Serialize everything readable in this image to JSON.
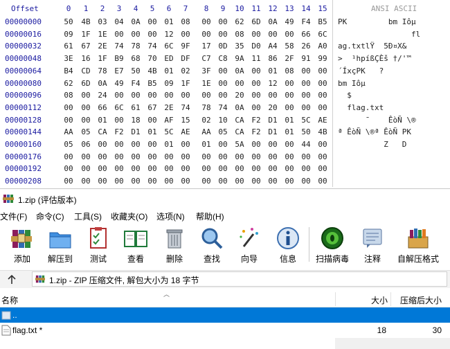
{
  "hex": {
    "offset_header": "Offset",
    "columns": [
      "0",
      "1",
      "2",
      "3",
      "4",
      "5",
      "6",
      "7",
      "8",
      "9",
      "10",
      "11",
      "12",
      "13",
      "14",
      "15"
    ],
    "ascii_header": "ANSI ASCII",
    "rows": [
      {
        "offset": "00000000",
        "bytes": [
          "50",
          "4B",
          "03",
          "04",
          "0A",
          "00",
          "01",
          "08",
          "00",
          "00",
          "62",
          "6D",
          "0A",
          "49",
          "F4",
          "B5"
        ],
        "ascii": "PK         bm Iôµ"
      },
      {
        "offset": "00000016",
        "bytes": [
          "09",
          "1F",
          "1E",
          "00",
          "00",
          "00",
          "12",
          "00",
          "00",
          "00",
          "08",
          "00",
          "00",
          "00",
          "66",
          "6C"
        ],
        "ascii": "                fl"
      },
      {
        "offset": "00000032",
        "bytes": [
          "61",
          "67",
          "2E",
          "74",
          "78",
          "74",
          "6C",
          "9F",
          "17",
          "0D",
          "35",
          "D0",
          "A4",
          "58",
          "26",
          "A0"
        ],
        "ascii": "ag.txtlŸ  5Ð¤X&"
      },
      {
        "offset": "00000048",
        "bytes": [
          "3E",
          "16",
          "1F",
          "B9",
          "68",
          "70",
          "ED",
          "DF",
          "C7",
          "C8",
          "9A",
          "11",
          "86",
          "2F",
          "91",
          "99"
        ],
        "ascii": ">  ¹hpíßÇÈš †/'™"
      },
      {
        "offset": "00000064",
        "bytes": [
          "B4",
          "CD",
          "78",
          "E7",
          "50",
          "4B",
          "01",
          "02",
          "3F",
          "00",
          "0A",
          "00",
          "01",
          "08",
          "00",
          "00"
        ],
        "ascii": "´ÍxçPK   ?"
      },
      {
        "offset": "00000080",
        "bytes": [
          "62",
          "6D",
          "0A",
          "49",
          "F4",
          "B5",
          "09",
          "1F",
          "1E",
          "00",
          "00",
          "00",
          "12",
          "00",
          "00",
          "00"
        ],
        "ascii": "bm Iôµ"
      },
      {
        "offset": "00000096",
        "bytes": [
          "08",
          "00",
          "24",
          "00",
          "00",
          "00",
          "00",
          "00",
          "00",
          "00",
          "20",
          "00",
          "00",
          "00",
          "00",
          "00"
        ],
        "ascii": "  $"
      },
      {
        "offset": "00000112",
        "bytes": [
          "00",
          "00",
          "66",
          "6C",
          "61",
          "67",
          "2E",
          "74",
          "78",
          "74",
          "0A",
          "00",
          "20",
          "00",
          "00",
          "00"
        ],
        "ascii": "  flag.txt"
      },
      {
        "offset": "00000128",
        "bytes": [
          "00",
          "00",
          "01",
          "00",
          "18",
          "00",
          "AF",
          "15",
          "02",
          "10",
          "CA",
          "F2",
          "D1",
          "01",
          "5C",
          "AE"
        ],
        "ascii": "      ¯    ÊòÑ \\®"
      },
      {
        "offset": "00000144",
        "bytes": [
          "AA",
          "05",
          "CA",
          "F2",
          "D1",
          "01",
          "5C",
          "AE",
          "AA",
          "05",
          "CA",
          "F2",
          "D1",
          "01",
          "50",
          "4B"
        ],
        "ascii": "ª ÊòÑ \\®ª ÊòÑ PK"
      },
      {
        "offset": "00000160",
        "bytes": [
          "05",
          "06",
          "00",
          "00",
          "00",
          "00",
          "01",
          "00",
          "01",
          "00",
          "5A",
          "00",
          "00",
          "00",
          "44",
          "00"
        ],
        "ascii": "          Z   D"
      },
      {
        "offset": "00000176",
        "bytes": [
          "00",
          "00",
          "00",
          "00",
          "00",
          "00",
          "00",
          "00",
          "00",
          "00",
          "00",
          "00",
          "00",
          "00",
          "00",
          "00"
        ],
        "ascii": ""
      },
      {
        "offset": "00000192",
        "bytes": [
          "00",
          "00",
          "00",
          "00",
          "00",
          "00",
          "00",
          "00",
          "00",
          "00",
          "00",
          "00",
          "00",
          "00",
          "00",
          "00"
        ],
        "ascii": ""
      },
      {
        "offset": "00000208",
        "bytes": [
          "00",
          "00",
          "00",
          "00",
          "00",
          "00",
          "00",
          "00",
          "00",
          "00",
          "00",
          "00",
          "00",
          "00",
          "00",
          "00"
        ],
        "ascii": ""
      }
    ]
  },
  "window": {
    "title": "1.zip (评估版本)",
    "icon": "winrar-icon"
  },
  "menu": [
    "文件(F)",
    "命令(C)",
    "工具(S)",
    "收藏夹(O)",
    "选项(N)",
    "帮助(H)"
  ],
  "toolbar": [
    {
      "label": "添加",
      "icon": "add-books-icon"
    },
    {
      "label": "解压到",
      "icon": "extract-folder-icon"
    },
    {
      "label": "测试",
      "icon": "test-clipboard-icon"
    },
    {
      "label": "查看",
      "icon": "view-book-icon"
    },
    {
      "label": "删除",
      "icon": "trash-icon"
    },
    {
      "label": "查找",
      "icon": "magnifier-icon"
    },
    {
      "label": "向导",
      "icon": "wizard-wand-icon"
    },
    {
      "label": "信息",
      "icon": "info-icon"
    },
    {
      "label": "扫描病毒",
      "icon": "virus-scan-icon"
    },
    {
      "label": "注释",
      "icon": "comment-icon"
    },
    {
      "label": "自解压格式",
      "icon": "sfx-box-icon"
    }
  ],
  "address": {
    "path": "1.zip - ZIP 压缩文件, 解包大小为 18 字节"
  },
  "list": {
    "columns": {
      "name": "名称",
      "size": "大小",
      "packed": "压缩后大小"
    },
    "rows": [
      {
        "name": "..",
        "size": "",
        "packed": "",
        "selected": true
      },
      {
        "name": "flag.txt *",
        "size": "18",
        "packed": "30",
        "selected": false
      }
    ]
  },
  "colors": {
    "selection": "#0078d7",
    "hex_offset": "#1a1aa0"
  }
}
